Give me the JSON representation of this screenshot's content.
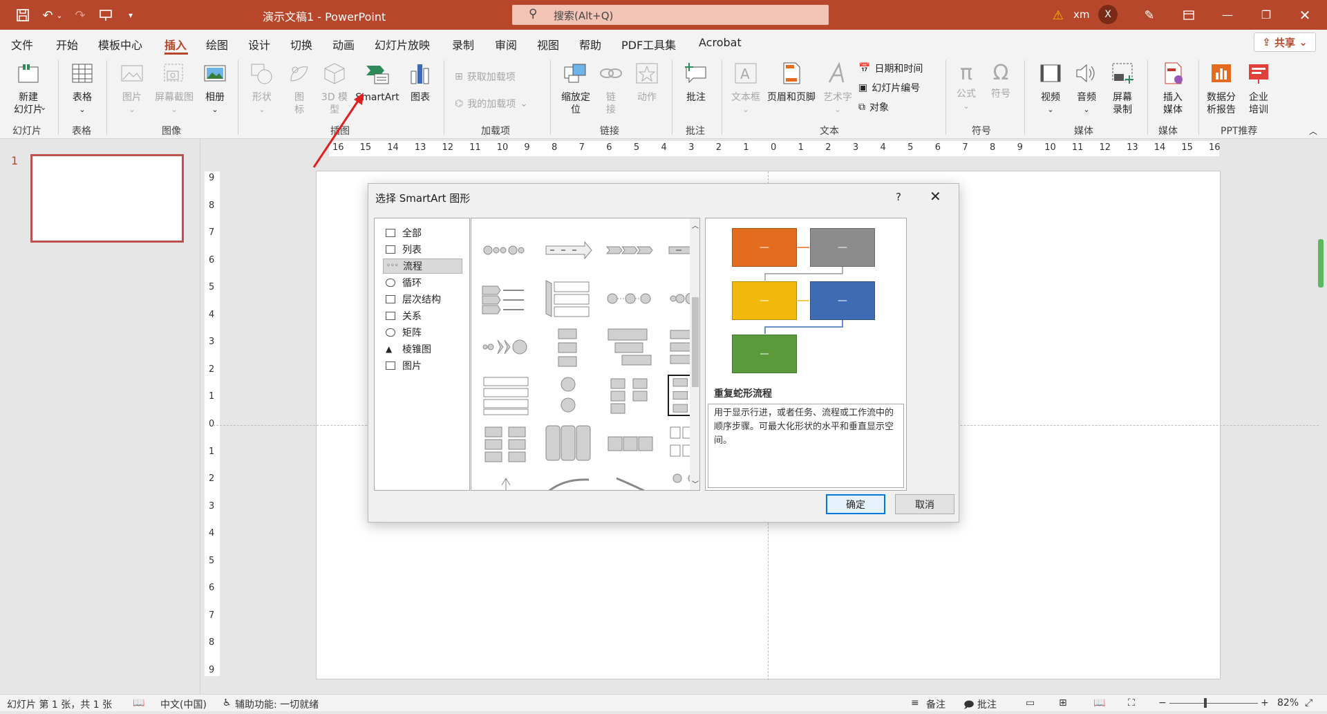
{
  "titlebar": {
    "doc_title": "演示文稿1  -  PowerPoint",
    "search_placeholder": "搜索(Alt+Q)",
    "user_name": "xm",
    "avatar_letter": "X"
  },
  "menu": {
    "items": [
      "文件",
      "开始",
      "模板中心",
      "插入",
      "绘图",
      "设计",
      "切换",
      "动画",
      "幻灯片放映",
      "录制",
      "审阅",
      "视图",
      "帮助",
      "PDF工具集",
      "Acrobat"
    ],
    "active": "插入",
    "share_label": "共享"
  },
  "ribbon": {
    "new_slide": "新建\n幻灯片",
    "table": "表格",
    "picture": "图片",
    "screenshot": "屏幕截图",
    "album": "相册",
    "shapes": "形状",
    "icons": "图\n标",
    "model3d": "3D 模\n型",
    "smartart": "SmartArt",
    "chart": "图表",
    "get_addins": "获取加载项",
    "my_addins": "我的加载项",
    "zoom": "缩放定\n位",
    "link": "链\n接",
    "action": "动作",
    "comment": "批注",
    "textbox": "文本框",
    "header_footer": "页眉和页脚",
    "wordart": "艺术字",
    "date_time": "日期和时间",
    "slide_number": "幻灯片编号",
    "object": "对象",
    "equation": "公式",
    "symbol": "符号",
    "video": "视频",
    "audio": "音频",
    "screen_record": "屏幕\n录制",
    "insert_media": "插入\n媒体",
    "data_report": "数据分\n析报告",
    "training": "企业\n培训",
    "groups": {
      "slides": "幻灯片",
      "tables": "表格",
      "images": "图像",
      "illustrations": "插图",
      "addins": "加载项",
      "links": "链接",
      "comments": "批注",
      "text": "文本",
      "symbols": "符号",
      "media": "媒体",
      "media2": "媒体",
      "ppt_recommend": "PPT推荐"
    }
  },
  "thumbs": {
    "slide_number": "1"
  },
  "hruler_ticks": [
    "16",
    "15",
    "14",
    "13",
    "12",
    "11",
    "10",
    "9",
    "8",
    "7",
    "6",
    "5",
    "4",
    "3",
    "2",
    "1",
    "0",
    "1",
    "2",
    "3",
    "4",
    "5",
    "6",
    "7",
    "8",
    "9",
    "10",
    "11",
    "12",
    "13",
    "14",
    "15",
    "16"
  ],
  "vruler_ticks": [
    "9",
    "8",
    "7",
    "6",
    "5",
    "4",
    "3",
    "2",
    "1",
    "0",
    "1",
    "2",
    "3",
    "4",
    "5",
    "6",
    "7",
    "8",
    "9"
  ],
  "dialog": {
    "title": "选择 SmartArt 图形",
    "help": "?",
    "categories": [
      "全部",
      "列表",
      "流程",
      "循环",
      "层次结构",
      "关系",
      "矩阵",
      "棱锥图",
      "图片"
    ],
    "selected_category": "流程",
    "preview_box_text": "—",
    "preview_colors": [
      "#e46c1f",
      "#8c8c8c",
      "#f2b90c",
      "#3f6bb5",
      "#5a9a3c"
    ],
    "preview_name": "重复蛇形流程",
    "preview_desc": "用于显示行进，或者任务、流程或工作流中的顺序步骤。可最大化形状的水平和垂直显示空间。",
    "ok": "确定",
    "cancel": "取消"
  },
  "status": {
    "slide_info": "幻灯片 第 1 张，共 1 张",
    "language": "中文(中国)",
    "accessibility": "辅助功能: 一切就绪",
    "notes": "备注",
    "comments": "批注",
    "zoom": "82%"
  }
}
